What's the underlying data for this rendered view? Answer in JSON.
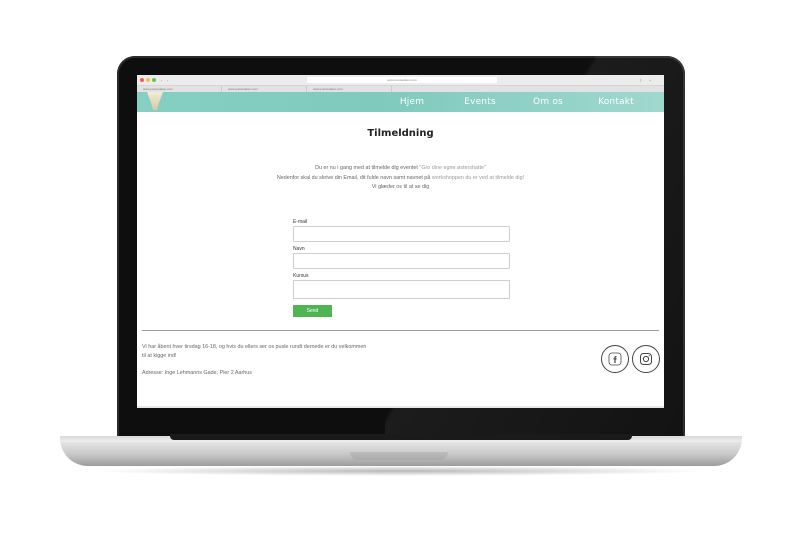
{
  "browser": {
    "url": "www.puusiedelen.com",
    "tabs": [
      "www.puusiedelen.com",
      "www.puusiedelen.com",
      "www.puusiedelen.com"
    ],
    "traffic_colors": [
      "#ee5f57",
      "#f6be4f",
      "#5fc84a"
    ]
  },
  "nav": {
    "logo": "hat-logo",
    "links": [
      "Hjem",
      "Events",
      "Om os",
      "Kontakt"
    ],
    "gradient": [
      "#86cfc3",
      "#9fd8cf"
    ]
  },
  "page": {
    "title": "Tilmeldning",
    "intro": {
      "line1_a": "Du er nu i gang med at tilmelde dig eventet ",
      "line1_b": "\"Gro dine egne østershatte\"",
      "line2_a": "Nedenfor skal du skrive din Email, dit fulde navn samt navnet på ",
      "line2_b": "workshoppen du er ved at tilmelde dig!",
      "line3": "Vi glæder os til at se dig"
    }
  },
  "form": {
    "email_label": "E-mail",
    "email_value": "",
    "name_label": "Navn",
    "name_value": "",
    "course_label": "Kursus",
    "course_value": "",
    "send_label": "Send",
    "send_color": "#4fb552"
  },
  "footer": {
    "hours_line1": "Vi har åbent hver tirsdag 16-18, og hvis du ellers ser os pusle rundt dernede er du velkommen",
    "hours_line2": "til at kigge ind!",
    "address": "Adresse: Inge Lehmanns Gade, Pier 2 Aarhus",
    "social": [
      "facebook-icon",
      "instagram-icon"
    ]
  }
}
